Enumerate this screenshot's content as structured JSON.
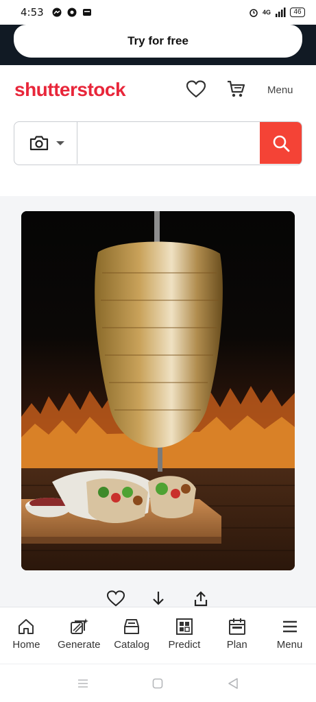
{
  "status_bar": {
    "time": "4:53",
    "network": "4G",
    "battery": "46"
  },
  "promo": {
    "button_label": "Try for free"
  },
  "header": {
    "logo": "shutterstock",
    "menu_label": "Menu",
    "icons": [
      "heart-icon",
      "cart-icon"
    ]
  },
  "search": {
    "value": "",
    "placeholder": "",
    "mode_icon": "camera-icon",
    "submit_icon": "search-icon",
    "accent_color": "#f44336"
  },
  "image": {
    "subject": "shawarma-spit-photo",
    "actions": [
      "heart-icon",
      "download-icon",
      "share-icon"
    ]
  },
  "bottom_nav": {
    "items": [
      {
        "label": "Home",
        "icon": "home-icon"
      },
      {
        "label": "Generate",
        "icon": "generate-icon"
      },
      {
        "label": "Catalog",
        "icon": "catalog-icon"
      },
      {
        "label": "Predict",
        "icon": "predict-icon"
      },
      {
        "label": "Plan",
        "icon": "plan-icon"
      },
      {
        "label": "Menu",
        "icon": "menu-icon"
      }
    ]
  },
  "colors": {
    "brand": "#e8263a",
    "promo_bg": "#111a24",
    "content_bg": "#f4f5f7"
  }
}
